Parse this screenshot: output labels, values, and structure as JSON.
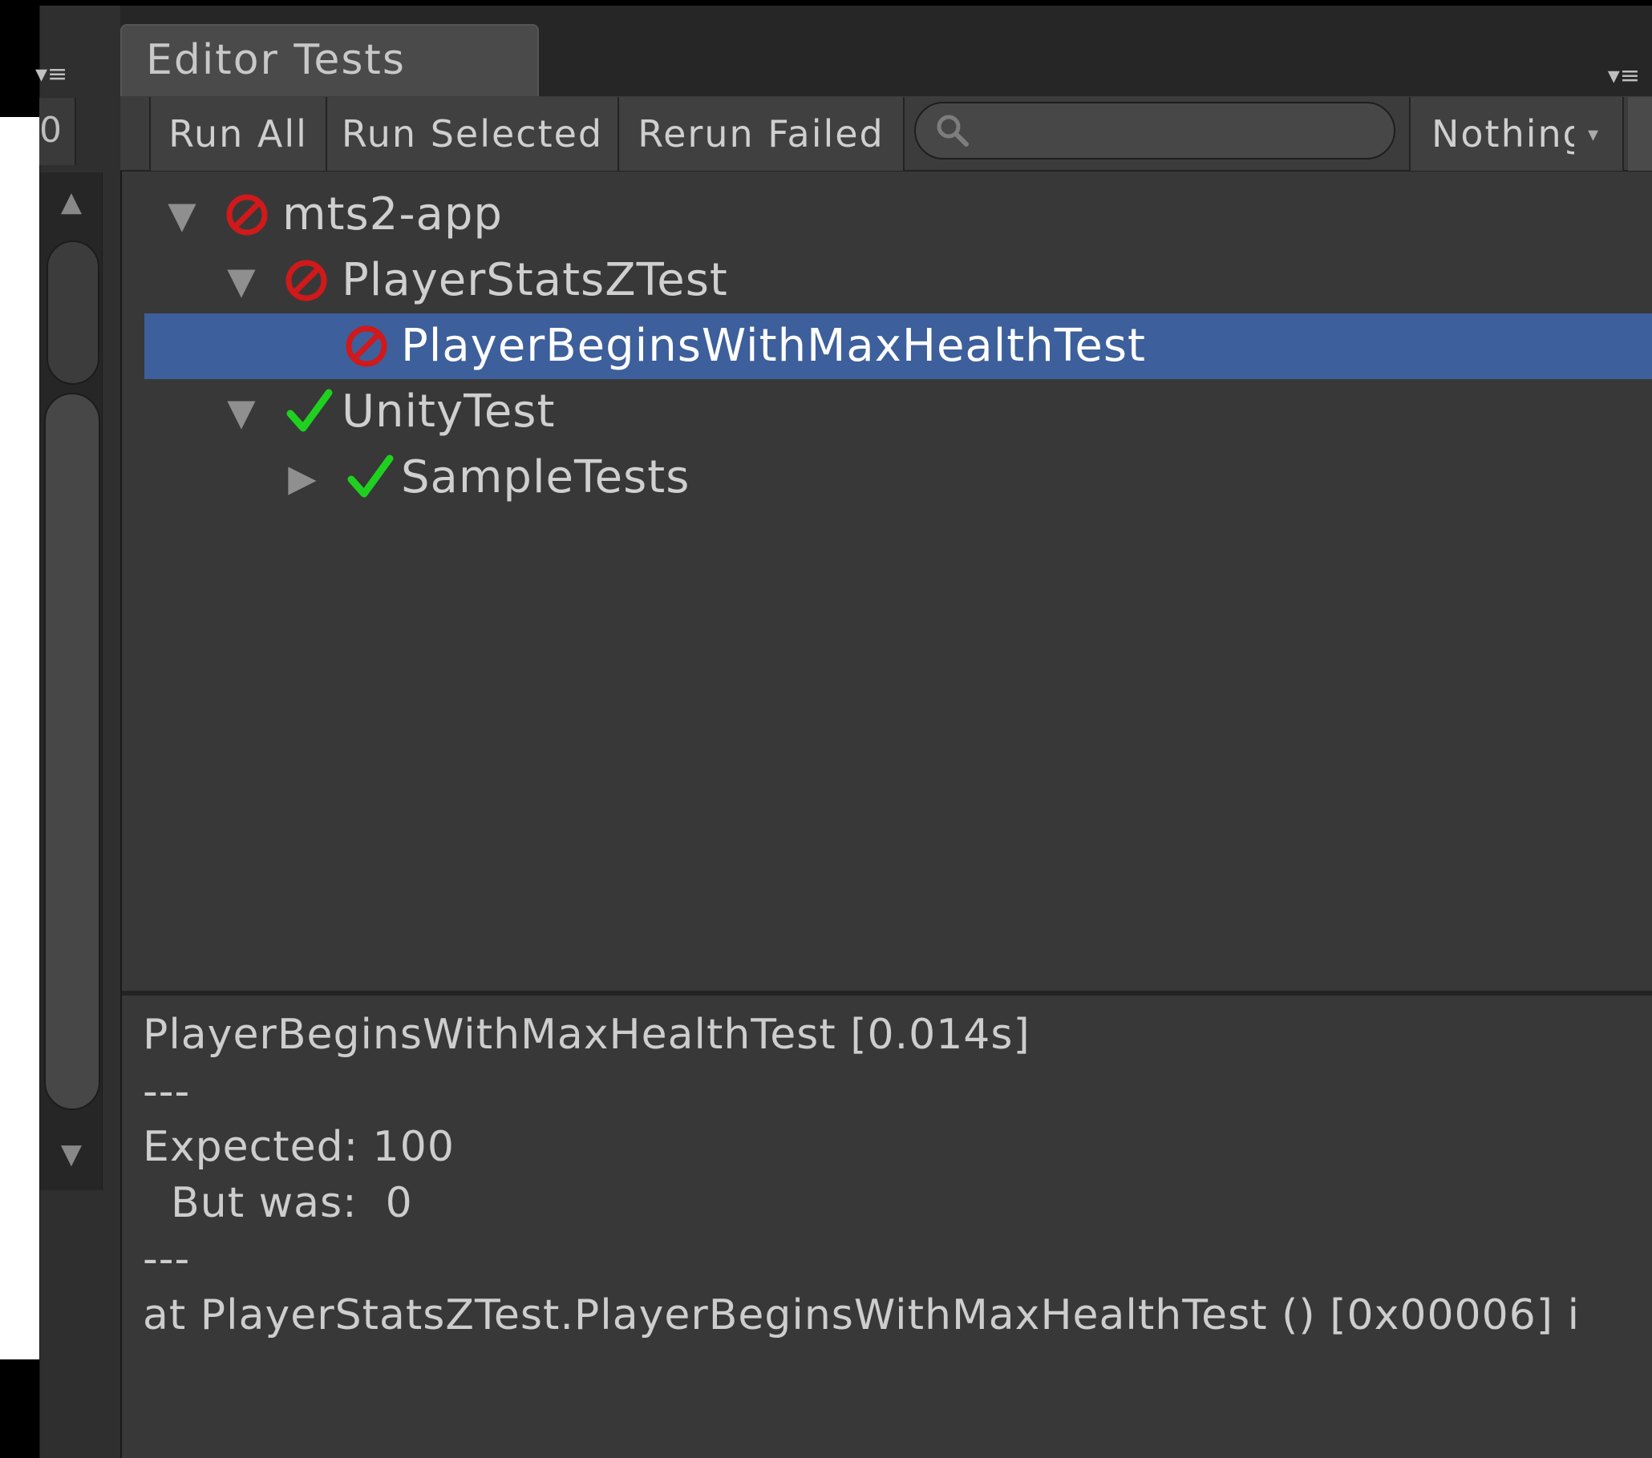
{
  "left_panel": {
    "field_text": "0",
    "menu_glyph": "▾≡",
    "scroll_up_glyph": "▲",
    "scroll_down_glyph": "▼"
  },
  "tab": {
    "title": "Editor Tests",
    "menu_glyph": "▾≡"
  },
  "toolbar": {
    "run_all_label": "Run All",
    "run_selected_label": "Run Selected",
    "rerun_failed_label": "Rerun Failed",
    "search_placeholder": "",
    "filter_label": "Nothing",
    "filter_chevron": "▾"
  },
  "tree": {
    "items": [
      {
        "label": "mts2-app",
        "status": "failed",
        "expanded": true,
        "level": 0,
        "chevron": "▼"
      },
      {
        "label": "PlayerStatsZTest",
        "status": "failed",
        "expanded": true,
        "level": 1,
        "chevron": "▼"
      },
      {
        "label": "PlayerBeginsWithMaxHealthTest",
        "status": "failed",
        "expanded": false,
        "level": 2,
        "selected": true,
        "chevron": ""
      },
      {
        "label": "UnityTest",
        "status": "passed",
        "expanded": true,
        "level": 1,
        "chevron": "▼"
      },
      {
        "label": "SampleTests",
        "status": "passed",
        "expanded": false,
        "level": 2,
        "chevron": "▶"
      }
    ]
  },
  "details": {
    "lines": [
      "PlayerBeginsWithMaxHealthTest [0.014s]",
      "---",
      "Expected: 100",
      "  But was:  0",
      "---",
      "at PlayerStatsZTest.PlayerBeginsWithMaxHealthTest () [0x00006] i"
    ]
  },
  "colors": {
    "failed": "#d0191a",
    "passed": "#1fd11f",
    "selection": "#3d5f9b",
    "panel_bg": "#383838"
  },
  "icons": {
    "failed": "failed-icon",
    "passed": "passed-icon",
    "search": "search-icon"
  }
}
